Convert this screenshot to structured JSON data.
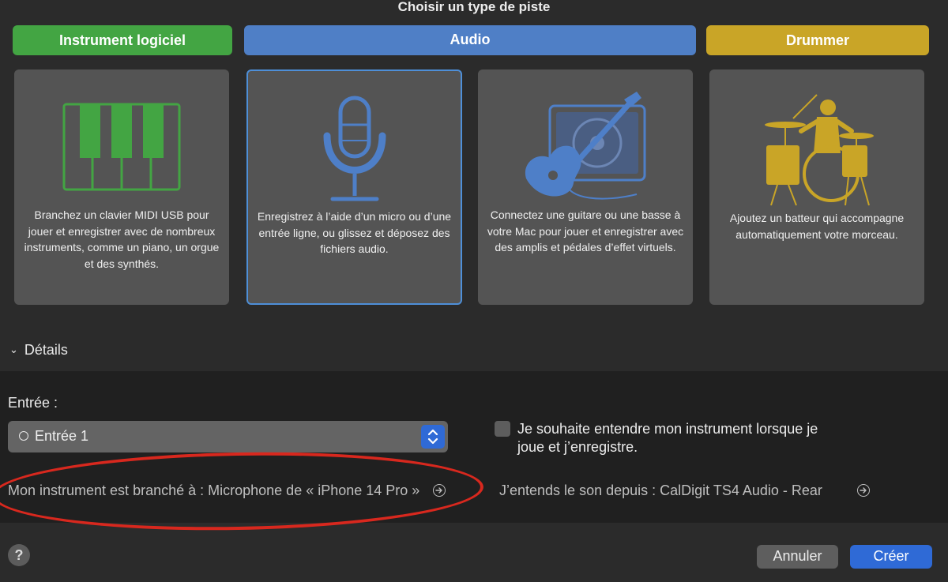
{
  "dialog": {
    "title": "Choisir un type de piste"
  },
  "track_types": [
    {
      "label": "Instrument logiciel",
      "color": "#43a543"
    },
    {
      "label": "Audio",
      "color": "#4f7fc6"
    },
    {
      "label": "Drummer",
      "color": "#c9a527"
    }
  ],
  "cards": [
    {
      "description": "Branchez un clavier MIDI USB pour jouer et enregistrer avec de nombreux instruments, comme un piano, un orgue et des synthés.",
      "icon": "piano-keys-icon"
    },
    {
      "description": "Enregistrez à l’aide d’un micro ou d’une entrée ligne, ou glissez et déposez des fichiers audio.",
      "icon": "microphone-icon",
      "selected": true
    },
    {
      "description": "Connectez une guitare ou une basse à votre Mac pour jouer et enregistrer avec des amplis et pédales d’effet virtuels.",
      "icon": "guitar-amp-icon"
    },
    {
      "description": "Ajoutez un batteur qui accompagne automatiquement votre morceau.",
      "icon": "drummer-icon"
    }
  ],
  "details": {
    "toggle_label": "Détails",
    "input_label": "Entrée :",
    "input_value": "Entrée 1",
    "monitor_checkbox_label": "Je souhaite entendre mon instrument lorsque je joue et j’enregistre.",
    "monitor_checked": false,
    "input_route": "Mon instrument est branché à : Microphone de « iPhone 14 Pro »",
    "output_route": "J’entends le son depuis : CalDigit TS4 Audio - Rear"
  },
  "footer": {
    "help_label": "?",
    "cancel_label": "Annuler",
    "create_label": "Créer"
  },
  "colors": {
    "accent_blue": "#2f6ad6",
    "selection_border": "#4e8fd8",
    "annotation_red": "#d8281e"
  }
}
